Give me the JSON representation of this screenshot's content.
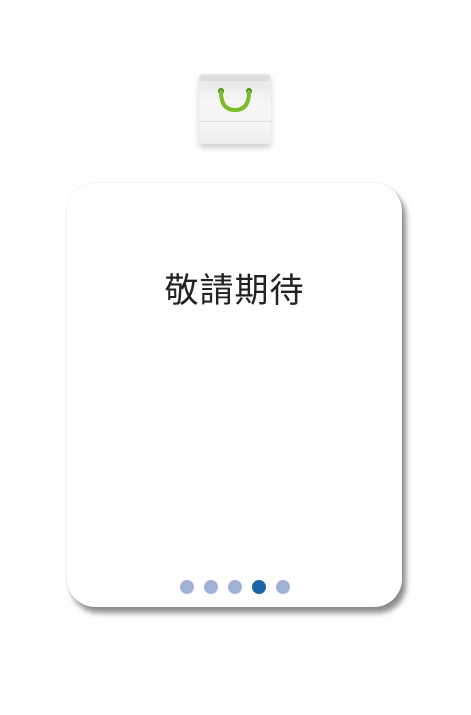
{
  "app_icon": {
    "name": "shopping-bag-icon",
    "handle_color": "#7cbb2a"
  },
  "card": {
    "title": "敬請期待"
  },
  "pagination": {
    "count": 5,
    "active_index": 3,
    "inactive_color": "#9fb2d6",
    "active_color": "#1a63a8"
  }
}
